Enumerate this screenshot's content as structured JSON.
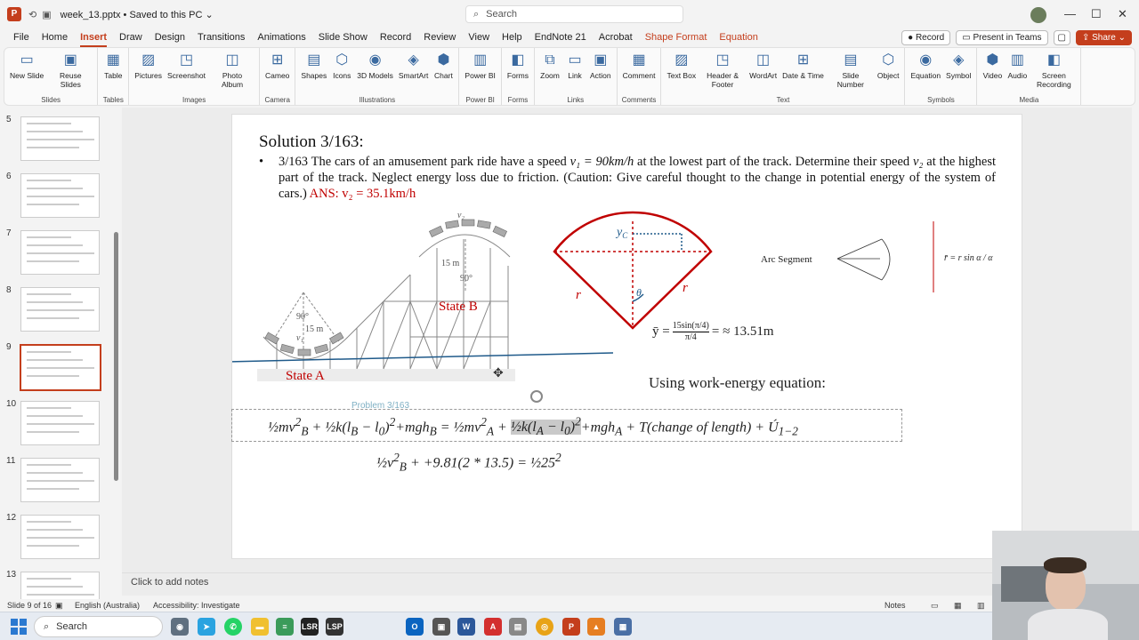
{
  "window": {
    "doc_title": "week_13.pptx • Saved to this PC ⌄",
    "search_placeholder": "Search",
    "minimize": "—",
    "maximize": "☐",
    "close": "✕"
  },
  "menu": {
    "tabs": [
      "File",
      "Home",
      "Insert",
      "Draw",
      "Design",
      "Transitions",
      "Animations",
      "Slide Show",
      "Record",
      "Review",
      "View",
      "Help",
      "EndNote 21",
      "Acrobat",
      "Shape Format",
      "Equation"
    ],
    "active": "Insert",
    "record_btn": "Record",
    "present_btn": "Present in Teams",
    "share_btn": "Share"
  },
  "ribbon": {
    "groups": [
      {
        "label": "Slides",
        "items": [
          "New Slide",
          "Reuse Slides"
        ]
      },
      {
        "label": "Tables",
        "items": [
          "Table"
        ]
      },
      {
        "label": "Images",
        "items": [
          "Pictures",
          "Screenshot",
          "Photo Album"
        ]
      },
      {
        "label": "Camera",
        "items": [
          "Cameo"
        ]
      },
      {
        "label": "Illustrations",
        "items": [
          "Shapes",
          "Icons",
          "3D Models",
          "SmartArt",
          "Chart"
        ]
      },
      {
        "label": "Power BI",
        "items": [
          "Power BI"
        ]
      },
      {
        "label": "Forms",
        "items": [
          "Forms"
        ]
      },
      {
        "label": "Links",
        "items": [
          "Zoom",
          "Link",
          "Action"
        ]
      },
      {
        "label": "Comments",
        "items": [
          "Comment"
        ]
      },
      {
        "label": "Text",
        "items": [
          "Text Box",
          "Header & Footer",
          "WordArt",
          "Date & Time",
          "Slide Number",
          "Object"
        ]
      },
      {
        "label": "Symbols",
        "items": [
          "Equation",
          "Symbol"
        ]
      },
      {
        "label": "Media",
        "items": [
          "Video",
          "Audio",
          "Screen Recording"
        ]
      }
    ]
  },
  "thumbnails": [
    "5",
    "6",
    "7",
    "8",
    "9",
    "10",
    "11",
    "12",
    "13"
  ],
  "selected_thumbnail": "9",
  "slide": {
    "title": "Solution 3/163:",
    "bullet_prefix": "3/163 The cars of an amusement park ride have a speed ",
    "v1": "v₁ = 90km/h",
    "bullet_mid": " at the lowest part of the track. Determine their speed ",
    "v2": "v₂",
    "bullet_end": " at the highest part of the track. Neglect energy loss due to friction. (Caution: Give careful thought to the change in potential energy of the system of cars.) ",
    "ans": "ANS: v₂ = 35.1km/h",
    "state_a": "State A",
    "state_b": "State B",
    "label_15m_left": "15 m",
    "label_90_left": "90°",
    "label_15m_right": "15 m",
    "label_90_right": "90°",
    "label_v1": "v₁",
    "label_v2": "v₂",
    "yc": "y",
    "yc_sub": "C",
    "r_left": "r",
    "r_right": "r",
    "theta": "θ",
    "arc_segment": "Arc Segment",
    "ybar_lhs": "ȳ =",
    "ybar_num": "15sin(π/4)",
    "ybar_den": "π/4",
    "ybar_rhs": "= ≈ 13.51m",
    "work_energy": "Using work-energy equation:",
    "problem_caption": "Problem 3/163",
    "eq1_lhs": "mv²_B + k(l_B − l₀)² + mgh_B",
    "eq2": "v²_B + +9.81(2 * 13.5) =",
    "eq2_rhs": "25²"
  },
  "notes_placeholder": "Click to add notes",
  "status": {
    "slide_of": "Slide 9 of 16",
    "language": "English (Australia)",
    "accessibility": "Accessibility: Investigate",
    "notes": "Notes"
  },
  "taskbar": {
    "search": "Search"
  },
  "colors": {
    "accent": "#c43e1c",
    "answer_red": "#c00000",
    "line_blue": "#1f5a8a"
  }
}
